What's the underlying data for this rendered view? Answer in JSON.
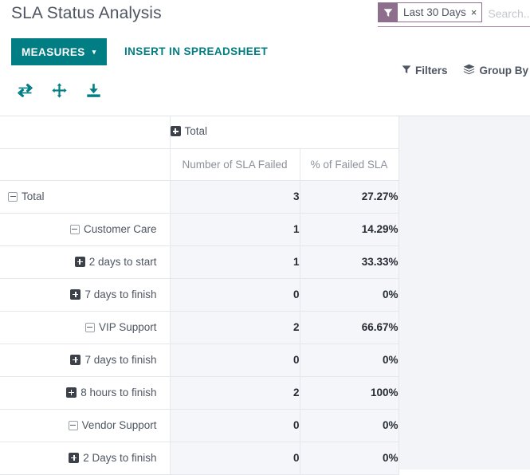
{
  "header": {
    "title": "SLA Status Analysis"
  },
  "search": {
    "facet_label": "Last 30 Days",
    "facet_remove": "×",
    "facet_icon": "filter-funnel-icon",
    "placeholder": "Search..."
  },
  "toolbar": {
    "measures_label": "MEASURES",
    "measures_caret": "▾",
    "insert_spreadsheet_label": "INSERT IN SPREADSHEET",
    "filters_label": "Filters",
    "group_by_label": "Group By",
    "icons": [
      {
        "name": "flip-axis-icon",
        "title": "Flip axis"
      },
      {
        "name": "expand-all-icon",
        "title": "Expand all"
      },
      {
        "name": "download-icon",
        "title": "Download xlsx"
      }
    ]
  },
  "colors": {
    "accent_teal": "#017e84",
    "facet_purple": "#8d6e8d",
    "cell_bg": "#f4f6f9",
    "grid_line": "#e4e7eb",
    "panel_bg": "#f2f4f7",
    "text_default": "#4e5662",
    "text_muted": "#8b9199"
  },
  "pivot": {
    "column_group": {
      "label": "Total",
      "toggle": "plus"
    },
    "measures": [
      "Number of SLA Failed",
      "% of Failed SLA"
    ],
    "rows": [
      {
        "label": "Total",
        "toggle": "minus",
        "indent": 0,
        "values": [
          "3",
          "27.27%"
        ]
      },
      {
        "label": "Customer Care",
        "toggle": "minus",
        "indent": 1,
        "values": [
          "1",
          "14.29%"
        ]
      },
      {
        "label": "2 days to start",
        "toggle": "plus",
        "indent": 2,
        "values": [
          "1",
          "33.33%"
        ]
      },
      {
        "label": "7 days to finish",
        "toggle": "plus",
        "indent": 2,
        "values": [
          "0",
          "0%"
        ]
      },
      {
        "label": "VIP Support",
        "toggle": "minus",
        "indent": 1,
        "values": [
          "2",
          "66.67%"
        ]
      },
      {
        "label": "7 days to finish",
        "toggle": "plus",
        "indent": 2,
        "values": [
          "0",
          "0%"
        ]
      },
      {
        "label": "8 hours to finish",
        "toggle": "plus",
        "indent": 2,
        "values": [
          "2",
          "100%"
        ]
      },
      {
        "label": "Vendor Support",
        "toggle": "minus",
        "indent": 1,
        "values": [
          "0",
          "0%"
        ]
      },
      {
        "label": "2 Days to finish",
        "toggle": "plus",
        "indent": 2,
        "values": [
          "0",
          "0%"
        ]
      }
    ]
  }
}
